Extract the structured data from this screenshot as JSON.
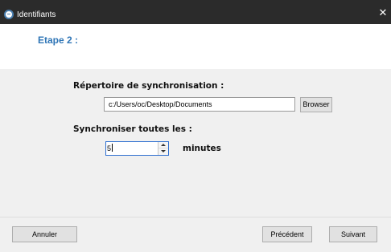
{
  "window": {
    "title": "Identifiants",
    "close_symbol": "✕"
  },
  "header": {
    "step_title": "Etape 2 :"
  },
  "form": {
    "sync_directory_label": "Répertoire de synchronisation :",
    "sync_directory_value": "c:/Users/oc/Desktop/Documents",
    "browse_label": "Browser",
    "sync_interval_label": "Synchroniser toutes les :",
    "sync_interval_value": "5",
    "sync_interval_unit": "minutes"
  },
  "footer": {
    "cancel_label": "Annuler",
    "previous_label": "Précédent",
    "next_label": "Suivant"
  },
  "icons": {
    "app": "app-logo-icon",
    "close": "close-icon",
    "spin_up": "chevron-up-icon",
    "spin_down": "chevron-down-icon"
  },
  "colors": {
    "title_bar": "#2b2b2b",
    "accent": "#2e75b6",
    "focus_border": "#2e6fd0"
  }
}
